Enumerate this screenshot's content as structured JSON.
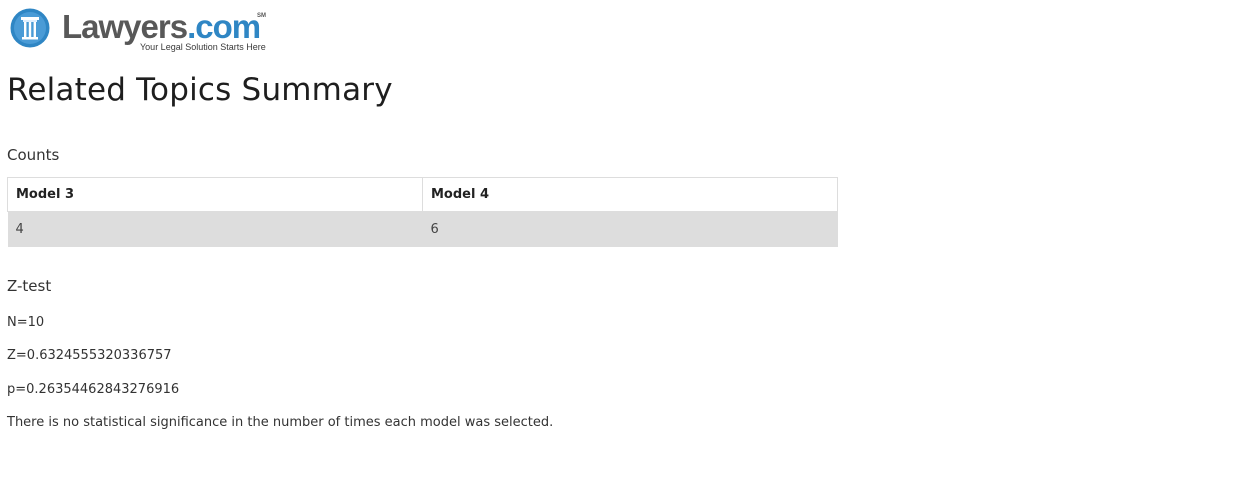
{
  "logo": {
    "brand_name": "Lawyers",
    "brand_tld": ".com",
    "service_mark": "SM",
    "tagline": "Your Legal Solution Starts Here",
    "icon": "courthouse-column-icon",
    "colors": {
      "circle": "#2f86c4",
      "wordmark": "#585858"
    }
  },
  "page": {
    "title": "Related Topics Summary"
  },
  "counts": {
    "heading": "Counts",
    "columns": [
      "Model 3",
      "Model 4"
    ],
    "rows": [
      [
        "4",
        "6"
      ]
    ],
    "row_background": "#dddddd"
  },
  "ztest": {
    "heading": "Z-test",
    "n_line": "N=10",
    "z_line": "Z=0.6324555320336757",
    "p_line": "p=0.26354462843276916",
    "conclusion": "There is no statistical significance in the number of times each model was selected."
  }
}
